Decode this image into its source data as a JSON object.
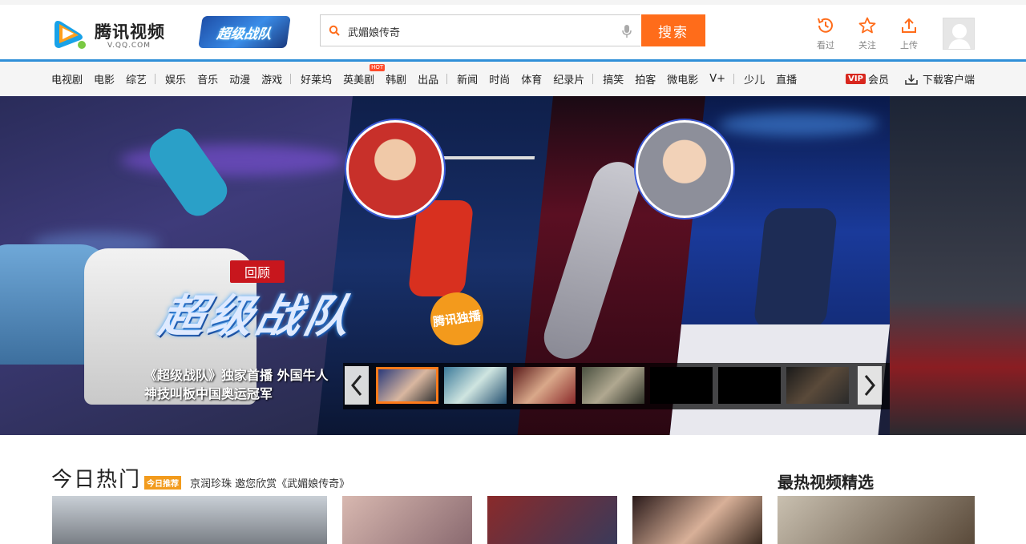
{
  "brand": {
    "name": "腾讯视频",
    "url": "V.QQ.COM",
    "promo": "超级战队"
  },
  "search": {
    "value": "武媚娘传奇",
    "button": "搜索"
  },
  "header_actions": [
    {
      "label": "看过",
      "icon": "history-clock-icon"
    },
    {
      "label": "关注",
      "icon": "star-icon"
    },
    {
      "label": "上传",
      "icon": "upload-icon"
    }
  ],
  "nav": {
    "items": [
      "电视剧",
      "电影",
      "综艺",
      "娱乐",
      "音乐",
      "动漫",
      "游戏",
      "好莱坞",
      "英美剧",
      "韩剧",
      "出品",
      "新闻",
      "时尚",
      "体育",
      "纪录片",
      "搞笑",
      "拍客",
      "微电影",
      "V+",
      "少儿",
      "直播"
    ],
    "hot_badge": "HOT",
    "vip_badge": "VIP",
    "vip_label": "会员",
    "download_label": "下载客户端"
  },
  "banner": {
    "review_tag": "回顾",
    "show_title": "超级战队",
    "badge": "腾讯独播",
    "caption_line1": "《超级战队》独家首播 外国牛人",
    "caption_line2": "神技叫板中国奥运冠军"
  },
  "main": {
    "section_title": "今日热门",
    "today_tag": "今日推荐",
    "today_text": "京润珍珠 邀您欣赏《武媚娘传奇》",
    "right_title": "最热视频精选"
  },
  "colors": {
    "accent": "#ff6c1a",
    "nav_line": "#2f8fd8",
    "vip": "#d8271e",
    "today_tag": "#f29b1d"
  }
}
